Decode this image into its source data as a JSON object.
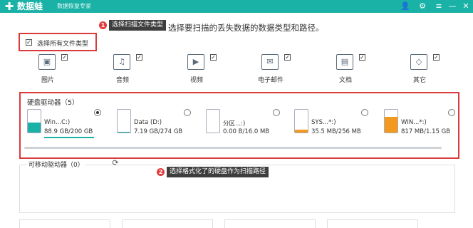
{
  "app": {
    "logo_glyph": "✚",
    "name": "数据蛙",
    "subtitle": "数据恢复专家"
  },
  "titlebar_icons": {
    "account": "👤",
    "settings": "⚙",
    "menu": "≡",
    "minimize": "—",
    "close": "✕"
  },
  "instruction": "选择要扫描的丢失数据的数据类型和路径。",
  "callouts": {
    "one": {
      "number": "1",
      "text": "选择扫描文件类型"
    },
    "two": {
      "number": "2",
      "text": "选择格式化了的硬盘作为扫描路径"
    }
  },
  "select_all": {
    "label": "选择所有文件类型",
    "checked": true,
    "check_glyph": "✓"
  },
  "file_types": [
    {
      "label": "图片",
      "icon": "image-icon",
      "glyph": "▣",
      "checked": true
    },
    {
      "label": "音频",
      "icon": "music-icon",
      "glyph": "♫",
      "checked": true
    },
    {
      "label": "视频",
      "icon": "video-icon",
      "glyph": "▶",
      "checked": true
    },
    {
      "label": "电子邮件",
      "icon": "email-icon",
      "glyph": "✉",
      "checked": true
    },
    {
      "label": "文档",
      "icon": "document-icon",
      "glyph": "▤",
      "checked": true
    },
    {
      "label": "其它",
      "icon": "other-icon",
      "glyph": "◇",
      "checked": true
    }
  ],
  "hard_drives": {
    "title": "硬盘驱动器（5）",
    "items": [
      {
        "name": "Win...C:)",
        "size": "88.9 GB/200 GB",
        "used_fraction": 0.44,
        "fill_color": "#1ab1a6",
        "selected": true
      },
      {
        "name": "Data (D:)",
        "size": "7.19 GB/274 GB",
        "used_fraction": 0.03,
        "fill_color": "#1ab1a6",
        "selected": false
      },
      {
        "name": "分区...:)",
        "size": "0.00  B/16.0 MB",
        "used_fraction": 0.0,
        "fill_color": "#f0a030",
        "selected": false
      },
      {
        "name": "SYS...*:)",
        "size": "35.5 MB/256 MB",
        "used_fraction": 0.14,
        "fill_color": "#f39a1e",
        "selected": false
      },
      {
        "name": "WIN...*:)",
        "size": "817 MB/1.15 GB",
        "used_fraction": 0.7,
        "fill_color": "#f39a1e",
        "selected": false
      }
    ]
  },
  "removable_drives": {
    "title": "可移动驱动器（0）",
    "refresh_glyph": "⟳"
  }
}
